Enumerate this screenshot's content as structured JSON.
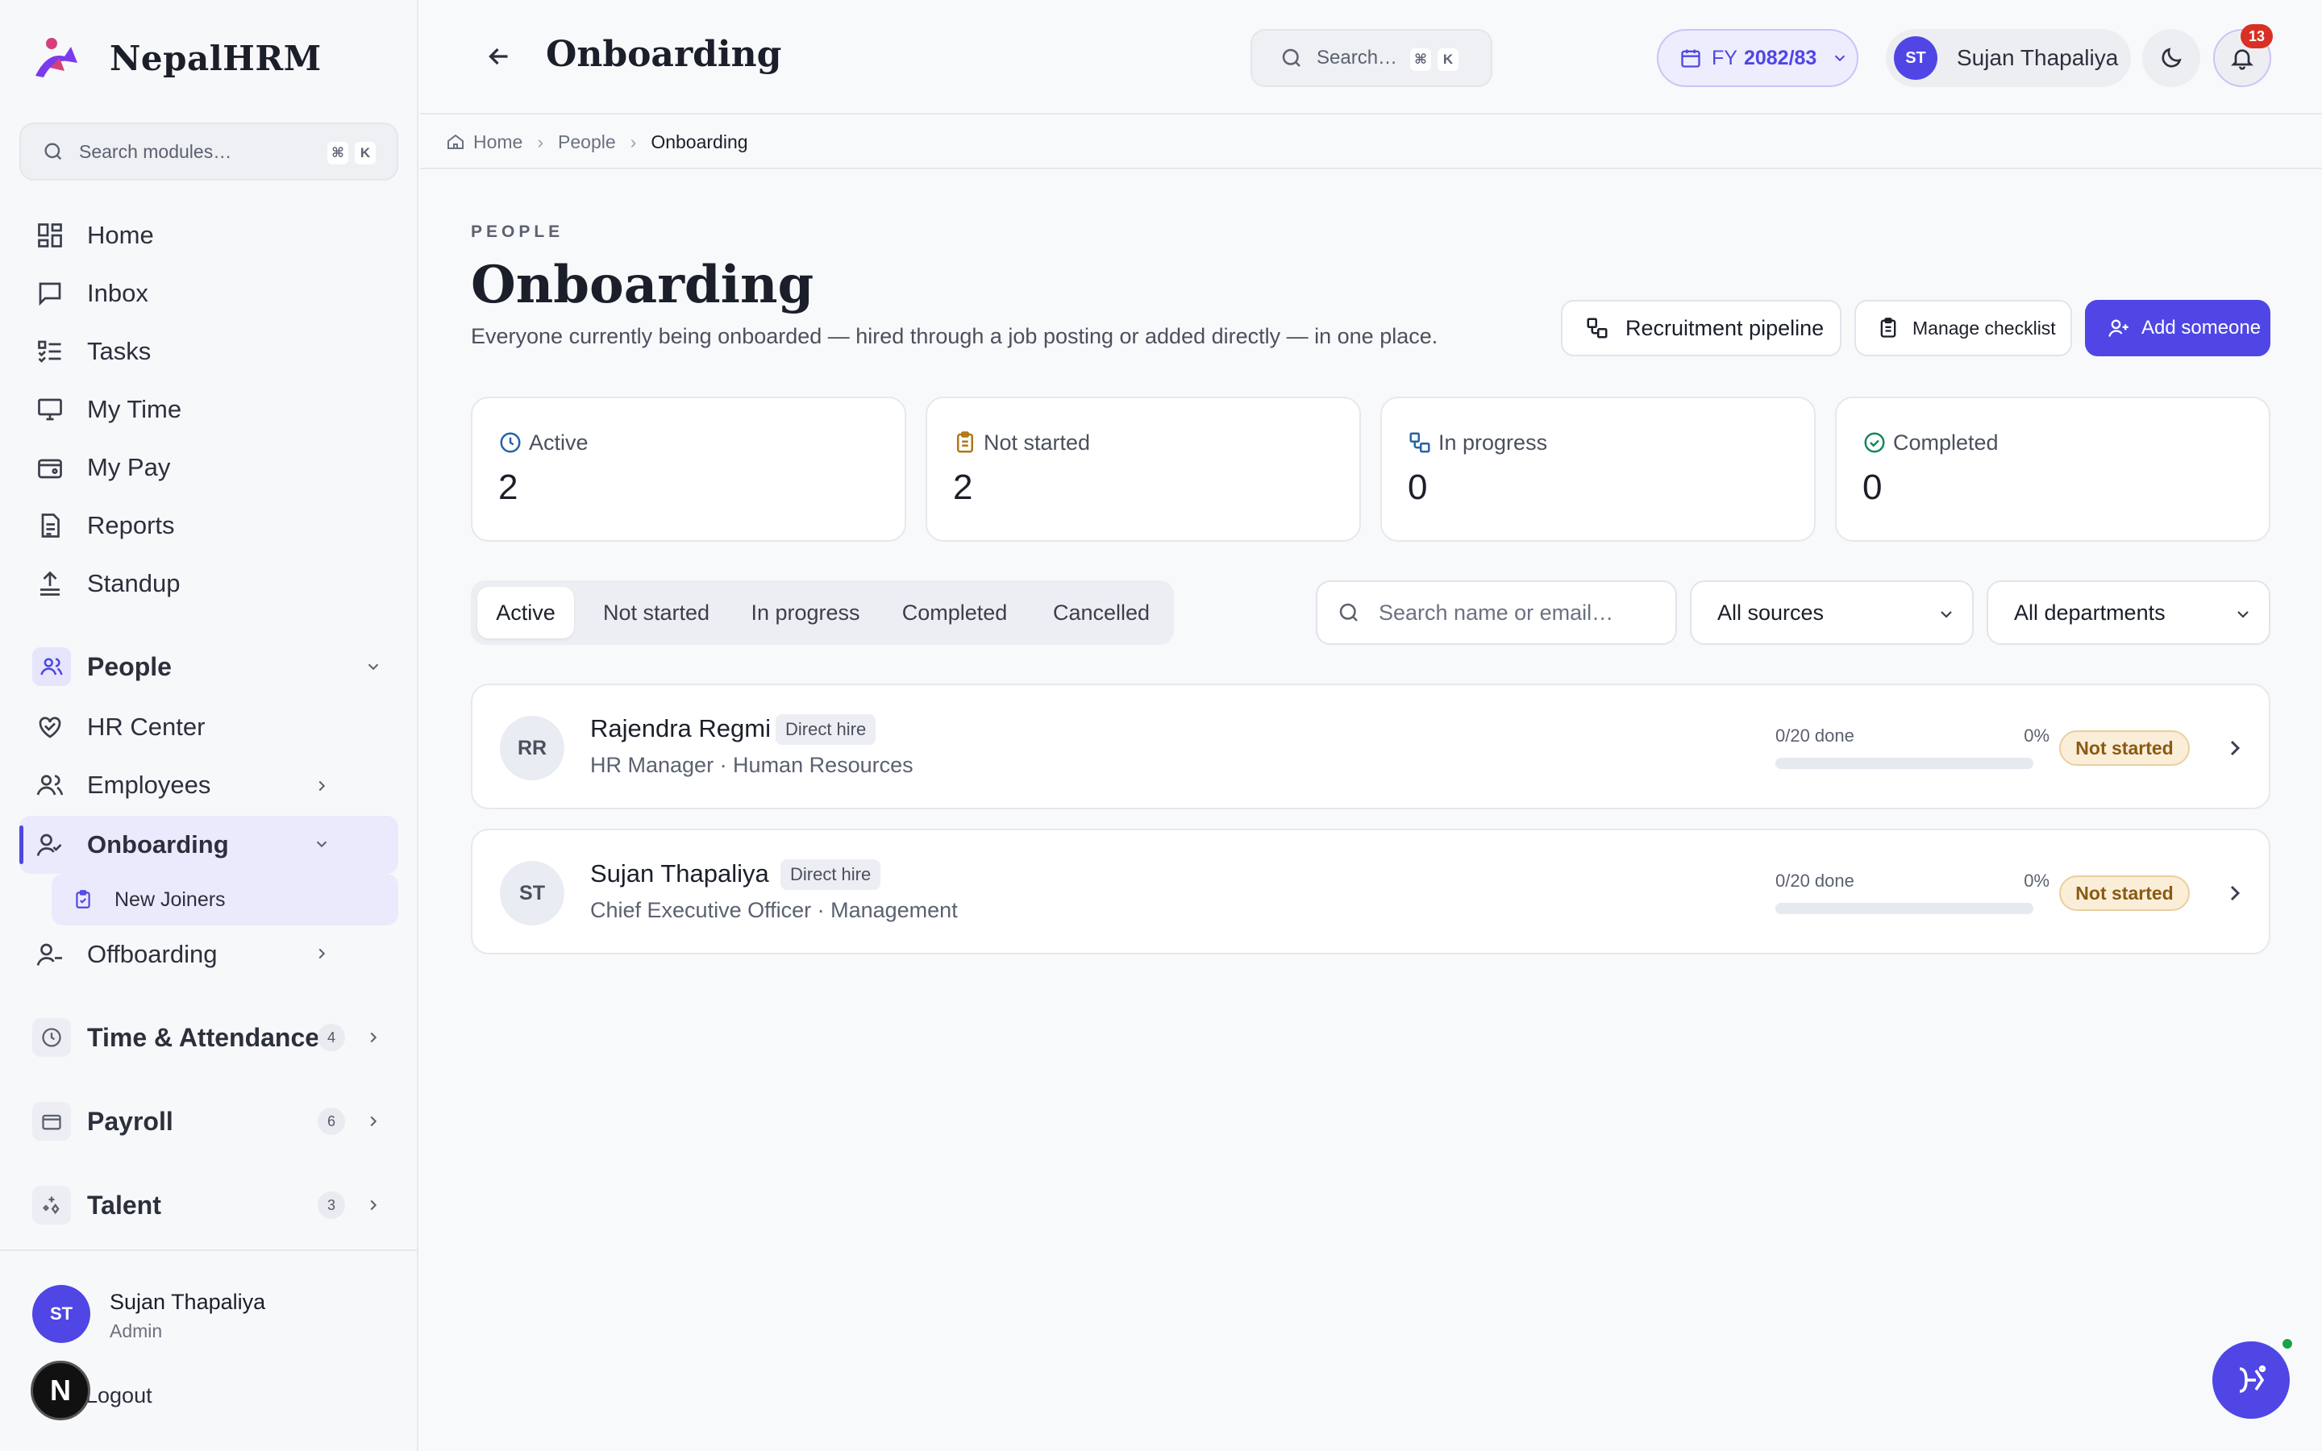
{
  "brand": {
    "name": "NepalHRM"
  },
  "sidebar": {
    "search_placeholder": "Search modules…",
    "kbd_cmd": "⌘",
    "kbd_key": "K",
    "nav": [
      "Home",
      "Inbox",
      "Tasks",
      "My Time",
      "My Pay",
      "Reports",
      "Standup"
    ],
    "people_group": "People",
    "people_items": [
      "HR Center",
      "Employees",
      "Onboarding",
      "Offboarding"
    ],
    "onboarding_sub": "New Joiners",
    "groups": [
      {
        "label": "Time & Attendance",
        "count": "4"
      },
      {
        "label": "Payroll",
        "count": "6"
      },
      {
        "label": "Talent",
        "count": "3"
      }
    ],
    "user": {
      "initials": "ST",
      "name": "Sujan Thapaliya",
      "role": "Admin"
    },
    "logout": "Logout",
    "dev_badge": "N"
  },
  "topbar": {
    "title": "Onboarding",
    "search_placeholder": "Search…",
    "kbd_cmd": "⌘",
    "kbd_key": "K",
    "fy_prefix": "FY",
    "fy_value": "2082/83",
    "user_initials": "ST",
    "user_name": "Sujan Thapaliya",
    "notif_count": "13"
  },
  "breadcrumb": [
    "Home",
    "People",
    "Onboarding"
  ],
  "page": {
    "eyebrow": "PEOPLE",
    "title": "Onboarding",
    "description": "Everyone currently being onboarded — hired through a job posting or added directly — in one place.",
    "actions": {
      "pipeline": "Recruitment pipeline",
      "checklist": "Manage checklist",
      "add": "Add someone"
    }
  },
  "stats": [
    {
      "label": "Active",
      "value": "2"
    },
    {
      "label": "Not started",
      "value": "2"
    },
    {
      "label": "In progress",
      "value": "0"
    },
    {
      "label": "Completed",
      "value": "0"
    }
  ],
  "tabs": [
    "Active",
    "Not started",
    "In progress",
    "Completed",
    "Cancelled"
  ],
  "filters": {
    "search_placeholder": "Search name or email…",
    "source": "All sources",
    "department": "All departments"
  },
  "people": [
    {
      "initials": "RR",
      "name": "Rajendra Regmi",
      "tag": "Direct hire",
      "role": "HR Manager · Human Resources",
      "done": "0/20 done",
      "pct": "0%",
      "progress": 0,
      "status": "Not started"
    },
    {
      "initials": "ST",
      "name": "Sujan Thapaliya",
      "tag": "Direct hire",
      "role": "Chief Executive Officer · Management",
      "done": "0/20 done",
      "pct": "0%",
      "progress": 0,
      "status": "Not started"
    }
  ],
  "colors": {
    "accent": "#4f46e5",
    "status_bg": "#fbeed9",
    "status_text": "#8a5a12",
    "notif": "#d93025"
  }
}
